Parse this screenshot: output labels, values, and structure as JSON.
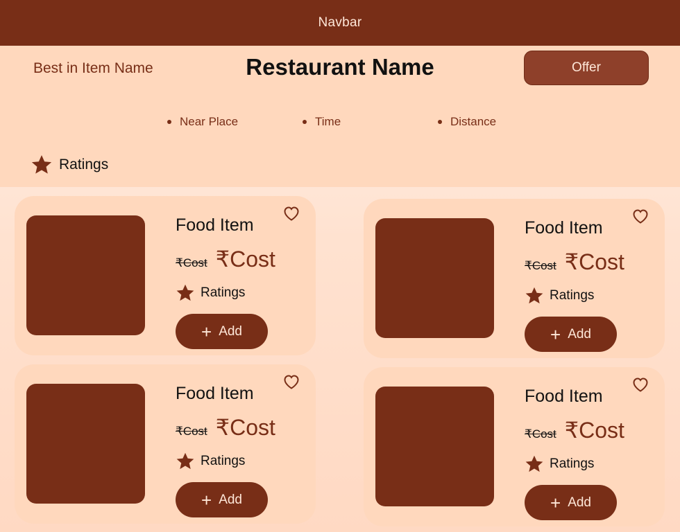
{
  "navbar": {
    "title": "Navbar"
  },
  "header": {
    "best_in": "Best in Item Name",
    "restaurant_name": "Restaurant Name",
    "offer_label": "Offer",
    "meta": [
      "Near Place",
      "Time",
      "Distance"
    ],
    "rating_label": "Ratings"
  },
  "icons": {
    "rating": "star-icon",
    "favorite": "heart-icon",
    "add": "plus-icon"
  },
  "colors": {
    "brand": "#782e17",
    "offer_button": "#8e402a",
    "panel": "#ffd8bd",
    "light_text": "#ffe7d8"
  },
  "cards": [
    {
      "name": "Food Item",
      "old_price": "₹Cost",
      "price": "₹Cost",
      "rating": "Ratings",
      "add_label": "Add"
    },
    {
      "name": "Food Item",
      "old_price": "₹Cost",
      "price": "₹Cost",
      "rating": "Ratings",
      "add_label": "Add"
    },
    {
      "name": "Food Item",
      "old_price": "₹Cost",
      "price": "₹Cost",
      "rating": "Ratings",
      "add_label": "Add"
    },
    {
      "name": "Food Item",
      "old_price": "₹Cost",
      "price": "₹Cost",
      "rating": "Ratings",
      "add_label": "Add"
    }
  ]
}
